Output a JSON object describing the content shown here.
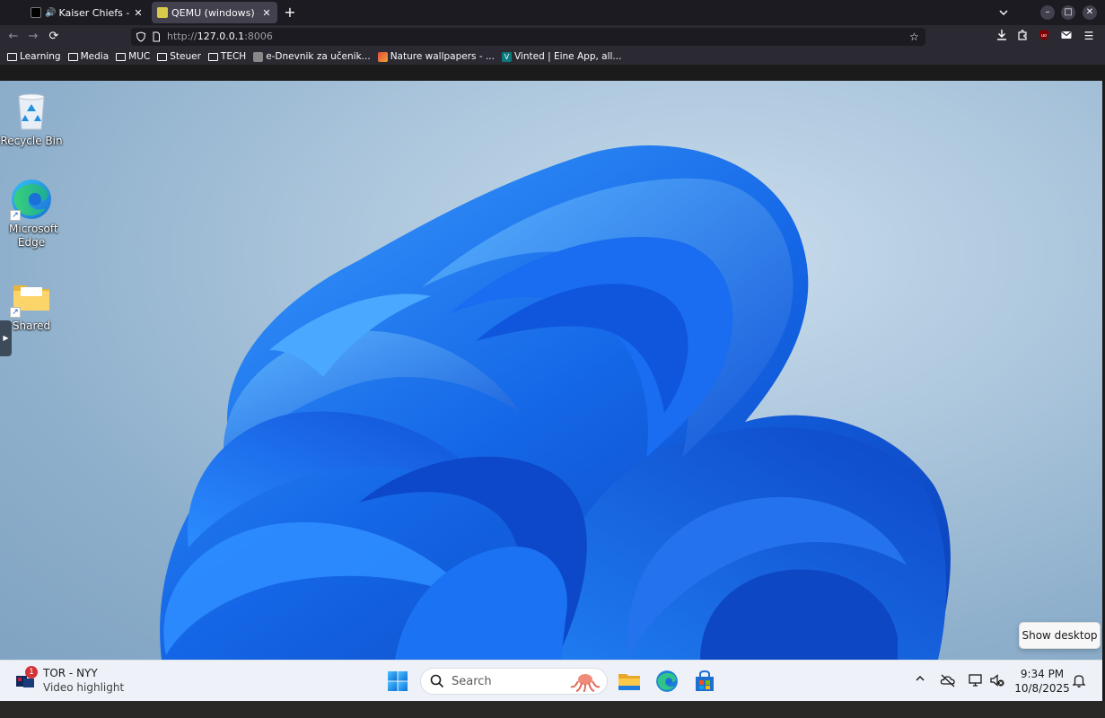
{
  "browser": {
    "tabs": [
      {
        "title": "Kaiser Chiefs - TIDAL",
        "active": false,
        "playing_audio": true
      },
      {
        "title": "QEMU (windows) - noVNC",
        "active": true,
        "playing_audio": false
      }
    ],
    "url": {
      "protocol": "http://",
      "host": "127.0.0.1",
      "port": ":8006"
    },
    "bookmarks": [
      {
        "label": "Learning",
        "type": "folder"
      },
      {
        "label": "Media",
        "type": "folder"
      },
      {
        "label": "MUC",
        "type": "folder"
      },
      {
        "label": "Steuer",
        "type": "folder"
      },
      {
        "label": "TECH",
        "type": "folder"
      },
      {
        "label": "e-Dnevnik za učenik...",
        "type": "link"
      },
      {
        "label": "Nature wallpapers - ...",
        "type": "link"
      },
      {
        "label": "Vinted | Eine App, all...",
        "type": "link"
      }
    ]
  },
  "desktop": {
    "icons": [
      {
        "label": "Recycle Bin",
        "icon": "recycle-bin-icon"
      },
      {
        "label": "Microsoft Edge",
        "icon": "edge-icon"
      },
      {
        "label": "Shared",
        "icon": "folder-icon"
      }
    ],
    "show_desktop_tooltip": "Show desktop"
  },
  "taskbar": {
    "widget": {
      "title": "TOR - NYY",
      "subtitle": "Video highlight",
      "badge": "1"
    },
    "search": {
      "placeholder": "Search"
    },
    "clock": {
      "time": "9:34 PM",
      "date": "10/8/2025"
    }
  },
  "colors": {
    "browser_bg": "#1c1b22",
    "toolbar_bg": "#2b2a33",
    "taskbar_bg": "#eef2f8",
    "accent_blue": "#0a5ce0",
    "badge_red": "#d13438"
  }
}
